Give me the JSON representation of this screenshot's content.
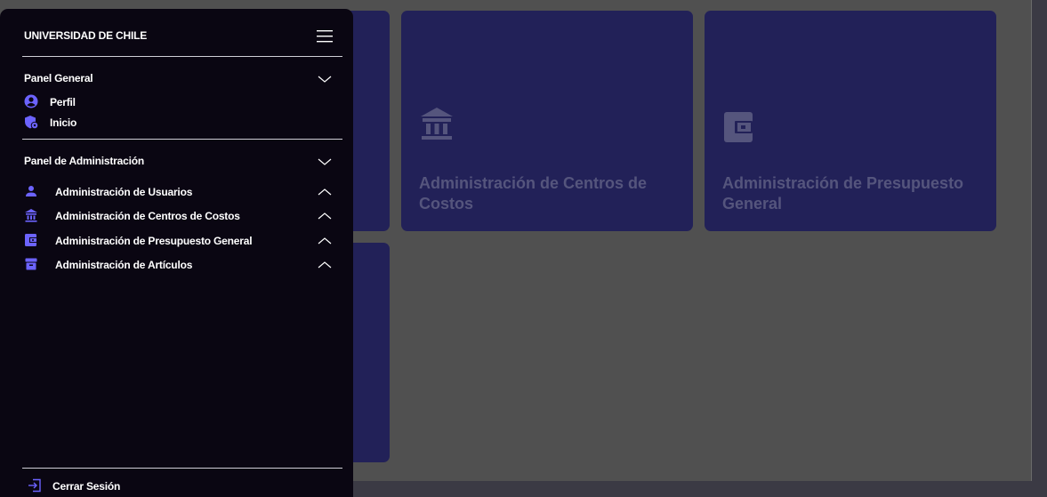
{
  "sidebar": {
    "title": "UNIVERSIDAD DE CHILE",
    "general_section": {
      "title": "Panel General",
      "items": [
        {
          "label": "Perfil",
          "icon": "account-circle-icon"
        },
        {
          "label": "Inicio",
          "icon": "shield-home-icon"
        }
      ]
    },
    "admin_section": {
      "title": "Panel de Administración",
      "items": [
        {
          "label": "Administración de Usuarios",
          "icon": "person-icon"
        },
        {
          "label": "Administración de Centros de Costos",
          "icon": "bank-icon"
        },
        {
          "label": "Administración de Presupuesto General",
          "icon": "wallet-icon"
        },
        {
          "label": "Administración de Artículos",
          "icon": "archive-box-icon"
        }
      ]
    },
    "logout_label": "Cerrar Sesión",
    "accent_color": "#6c63ff"
  },
  "cards": [
    {
      "title": "Administración de Centros de Costos",
      "icon": "bank-icon"
    },
    {
      "title": "Administración de Presupuesto General",
      "icon": "wallet-icon"
    }
  ],
  "colors": {
    "sidebar_bg": "#0a0612",
    "card_bg": "#222158",
    "overlay_bg": "#505050"
  }
}
